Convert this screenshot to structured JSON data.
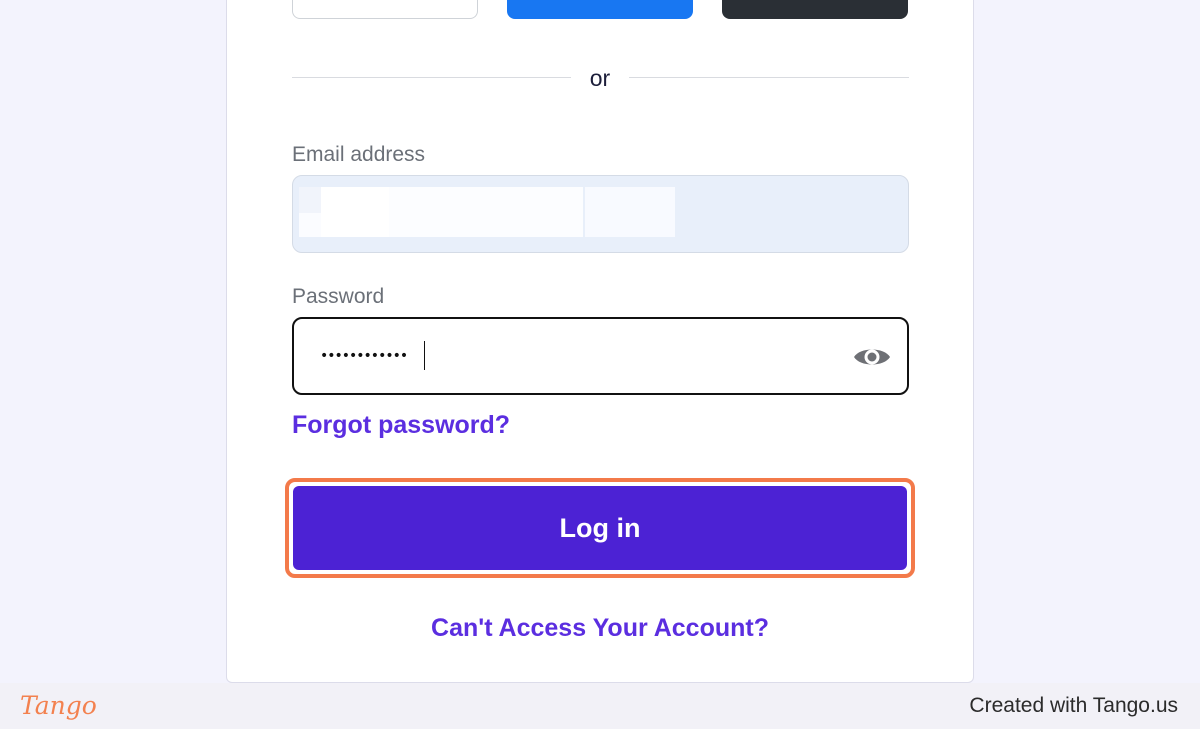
{
  "colors": {
    "page_background": "#f3f3fd",
    "accent_purple": "#4c22d4",
    "link_purple": "#5b2ee0",
    "highlight_orange": "#f37a4a",
    "facebook_blue": "#1877f2",
    "apple_dark": "#2a2f35"
  },
  "login_form": {
    "divider_text": "or",
    "email": {
      "label": "Email address",
      "value": ""
    },
    "password": {
      "label": "Password",
      "value": "••••••••••••",
      "toggle_icon": "eye-icon"
    },
    "forgot_password_link": "Forgot password?",
    "login_button_label": "Log in",
    "cant_access_link": "Can't Access Your Account?"
  },
  "footer": {
    "logo": "Tango",
    "credit": "Created with Tango.us"
  }
}
